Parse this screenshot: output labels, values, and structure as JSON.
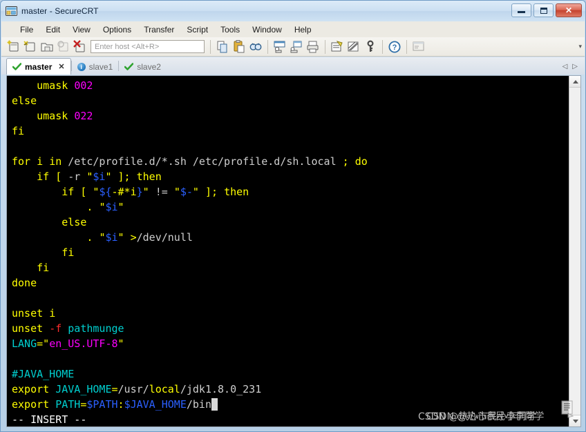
{
  "window": {
    "title": "master - SecureCRT",
    "icon": "securecrt-app-icon",
    "buttons": {
      "minimize": "minimize-button",
      "maximize": "maximize-button",
      "close_label": "✕"
    }
  },
  "menubar": {
    "items": [
      {
        "label": "File"
      },
      {
        "label": "Edit"
      },
      {
        "label": "View"
      },
      {
        "label": "Options"
      },
      {
        "label": "Transfer"
      },
      {
        "label": "Script"
      },
      {
        "label": "Tools"
      },
      {
        "label": "Window"
      },
      {
        "label": "Help"
      }
    ]
  },
  "toolbar": {
    "host_placeholder": "Enter host <Alt+R>",
    "host_value": "",
    "overflow_label": "▾",
    "icons": [
      {
        "name": "new-session-icon"
      },
      {
        "name": "connect-sftp-icon"
      },
      {
        "name": "connect-folder-icon"
      },
      {
        "name": "reconnect-icon"
      },
      {
        "name": "disconnect-icon"
      },
      {
        "name": "copy-icon"
      },
      {
        "name": "paste-icon"
      },
      {
        "name": "find-icon"
      },
      {
        "name": "print-screen-icon"
      },
      {
        "name": "log-session-icon"
      },
      {
        "name": "print-icon"
      },
      {
        "name": "session-options-icon"
      },
      {
        "name": "global-options-icon"
      },
      {
        "name": "key-icon"
      },
      {
        "name": "help-icon"
      },
      {
        "name": "chat-window-icon"
      }
    ]
  },
  "tabs": {
    "items": [
      {
        "label": "master",
        "status_icon": "green-check-icon",
        "active": true,
        "closable": true,
        "close_label": "✕"
      },
      {
        "label": "slave1",
        "status_icon": "blue-info-icon",
        "active": false,
        "closable": false,
        "close_label": ""
      },
      {
        "label": "slave2",
        "status_icon": "green-check-icon",
        "active": false,
        "closable": false,
        "close_label": ""
      }
    ],
    "scroll_left_label": "◁",
    "scroll_right_label": "▷"
  },
  "terminal": {
    "background": "#000000",
    "cursor_char": " ",
    "status_line": "-- INSERT --",
    "lines": [
      [
        {
          "t": "    ",
          "c": "pl"
        },
        {
          "t": "umask ",
          "c": "kw"
        },
        {
          "t": "002",
          "c": "num"
        }
      ],
      [
        {
          "t": "else",
          "c": "kw"
        }
      ],
      [
        {
          "t": "    ",
          "c": "pl"
        },
        {
          "t": "umask ",
          "c": "kw"
        },
        {
          "t": "022",
          "c": "num"
        }
      ],
      [
        {
          "t": "fi",
          "c": "kw"
        }
      ],
      [],
      [
        {
          "t": "for",
          "c": "kw"
        },
        {
          "t": " i ",
          "c": "kw"
        },
        {
          "t": "in",
          "c": "kw"
        },
        {
          "t": " /etc/profile.d/*.sh /etc/profile.d/sh.local ",
          "c": "pl"
        },
        {
          "t": ";",
          "c": "kw"
        },
        {
          "t": " ",
          "c": "pl"
        },
        {
          "t": "do",
          "c": "kw"
        }
      ],
      [
        {
          "t": "    ",
          "c": "pl"
        },
        {
          "t": "if",
          "c": "kw"
        },
        {
          "t": " ",
          "c": "pl"
        },
        {
          "t": "[",
          "c": "kw"
        },
        {
          "t": " -r ",
          "c": "pl"
        },
        {
          "t": "\"",
          "c": "kw"
        },
        {
          "t": "$i",
          "c": "var"
        },
        {
          "t": "\"",
          "c": "kw"
        },
        {
          "t": " ",
          "c": "pl"
        },
        {
          "t": "];",
          "c": "kw"
        },
        {
          "t": " ",
          "c": "pl"
        },
        {
          "t": "then",
          "c": "kw"
        }
      ],
      [
        {
          "t": "        ",
          "c": "pl"
        },
        {
          "t": "if",
          "c": "kw"
        },
        {
          "t": " ",
          "c": "pl"
        },
        {
          "t": "[",
          "c": "kw"
        },
        {
          "t": " ",
          "c": "pl"
        },
        {
          "t": "\"",
          "c": "kw"
        },
        {
          "t": "${",
          "c": "var"
        },
        {
          "t": "-#*i",
          "c": "kw"
        },
        {
          "t": "}",
          "c": "var"
        },
        {
          "t": "\"",
          "c": "kw"
        },
        {
          "t": " != ",
          "c": "pl"
        },
        {
          "t": "\"",
          "c": "kw"
        },
        {
          "t": "$-",
          "c": "var"
        },
        {
          "t": "\"",
          "c": "kw"
        },
        {
          "t": " ",
          "c": "pl"
        },
        {
          "t": "];",
          "c": "kw"
        },
        {
          "t": " ",
          "c": "pl"
        },
        {
          "t": "then",
          "c": "kw"
        }
      ],
      [
        {
          "t": "            ",
          "c": "pl"
        },
        {
          "t": ".",
          "c": "kw"
        },
        {
          "t": " ",
          "c": "pl"
        },
        {
          "t": "\"",
          "c": "kw"
        },
        {
          "t": "$i",
          "c": "var"
        },
        {
          "t": "\"",
          "c": "kw"
        }
      ],
      [
        {
          "t": "        ",
          "c": "pl"
        },
        {
          "t": "else",
          "c": "kw"
        }
      ],
      [
        {
          "t": "            ",
          "c": "pl"
        },
        {
          "t": ".",
          "c": "kw"
        },
        {
          "t": " ",
          "c": "pl"
        },
        {
          "t": "\"",
          "c": "kw"
        },
        {
          "t": "$i",
          "c": "var"
        },
        {
          "t": "\"",
          "c": "kw"
        },
        {
          "t": " ",
          "c": "pl"
        },
        {
          "t": ">",
          "c": "kw"
        },
        {
          "t": "/dev/null",
          "c": "pl"
        }
      ],
      [
        {
          "t": "        ",
          "c": "pl"
        },
        {
          "t": "fi",
          "c": "kw"
        }
      ],
      [
        {
          "t": "    ",
          "c": "pl"
        },
        {
          "t": "fi",
          "c": "kw"
        }
      ],
      [
        {
          "t": "done",
          "c": "kw"
        }
      ],
      [],
      [
        {
          "t": "unset",
          "c": "kw"
        },
        {
          "t": " ",
          "c": "pl"
        },
        {
          "t": "i",
          "c": "kw"
        }
      ],
      [
        {
          "t": "unset",
          "c": "kw"
        },
        {
          "t": " ",
          "c": "pl"
        },
        {
          "t": "-f",
          "c": "rd"
        },
        {
          "t": " ",
          "c": "pl"
        },
        {
          "t": "pathmunge",
          "c": "cy"
        }
      ],
      [
        {
          "t": "LANG",
          "c": "cy"
        },
        {
          "t": "=",
          "c": "kw"
        },
        {
          "t": "\"",
          "c": "kw"
        },
        {
          "t": "en_US.UTF-8",
          "c": "str"
        },
        {
          "t": "\"",
          "c": "kw"
        }
      ],
      [],
      [
        {
          "t": "#JAVA_HOME",
          "c": "cy"
        }
      ],
      [
        {
          "t": "export",
          "c": "kw"
        },
        {
          "t": " ",
          "c": "pl"
        },
        {
          "t": "JAVA_HOME",
          "c": "cy"
        },
        {
          "t": "=",
          "c": "kw"
        },
        {
          "t": "/usr/",
          "c": "pl"
        },
        {
          "t": "local",
          "c": "kw"
        },
        {
          "t": "/jdk1.8.0_231",
          "c": "pl"
        }
      ],
      [
        {
          "t": "export",
          "c": "kw"
        },
        {
          "t": " ",
          "c": "pl"
        },
        {
          "t": "PATH",
          "c": "cy"
        },
        {
          "t": "=",
          "c": "kw"
        },
        {
          "t": "$PATH",
          "c": "var"
        },
        {
          "t": ":",
          "c": "kw"
        },
        {
          "t": "$JAVA_HOME",
          "c": "var"
        },
        {
          "t": "/bin",
          "c": "pl"
        },
        {
          "t": " ",
          "c": "cur"
        }
      ]
    ]
  },
  "watermark": {
    "text_1": "CSDN @热心市民小李同学",
    "text_2": "CSDN @热心市民小李同学",
    "icon": "csdn-watermark-icon"
  },
  "colors": {
    "keyword": "#ffff00",
    "number": "#ff00ff",
    "variable": "#2b60ff",
    "identifier": "#00d0d0",
    "plain": "#cfcfcf",
    "flag": "#ff2d2d",
    "terminal_bg": "#000000"
  }
}
